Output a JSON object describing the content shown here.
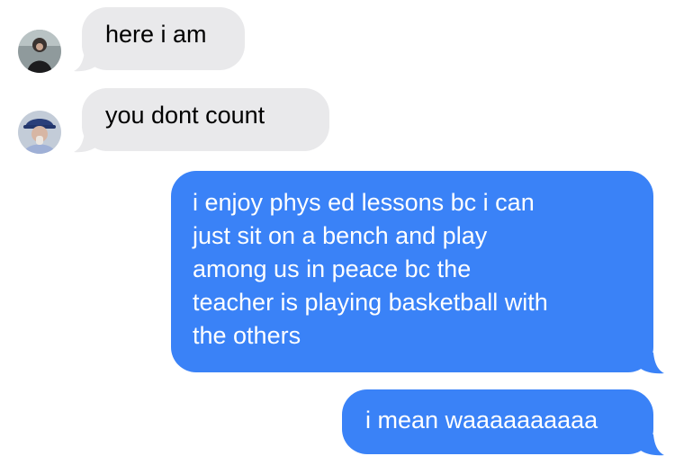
{
  "colors": {
    "incoming_bubble": "#e9e9eb",
    "outgoing_bubble": "#3a82f7",
    "incoming_text": "#000000",
    "outgoing_text": "#ffffff",
    "background": "#ffffff"
  },
  "messages": [
    {
      "direction": "incoming",
      "sender_avatar": "avatar-dark-jacket",
      "lines": [
        "here i am"
      ]
    },
    {
      "direction": "incoming",
      "sender_avatar": "avatar-blue-cap",
      "lines": [
        "you dont count"
      ]
    },
    {
      "direction": "outgoing",
      "lines": [
        "i enjoy phys ed lessons bc i can",
        "just sit on a bench and play",
        "among us in peace bc the",
        "teacher is playing basketball with",
        "the others"
      ]
    },
    {
      "direction": "outgoing",
      "lines": [
        "i mean waaaaaaaaaa"
      ]
    }
  ]
}
